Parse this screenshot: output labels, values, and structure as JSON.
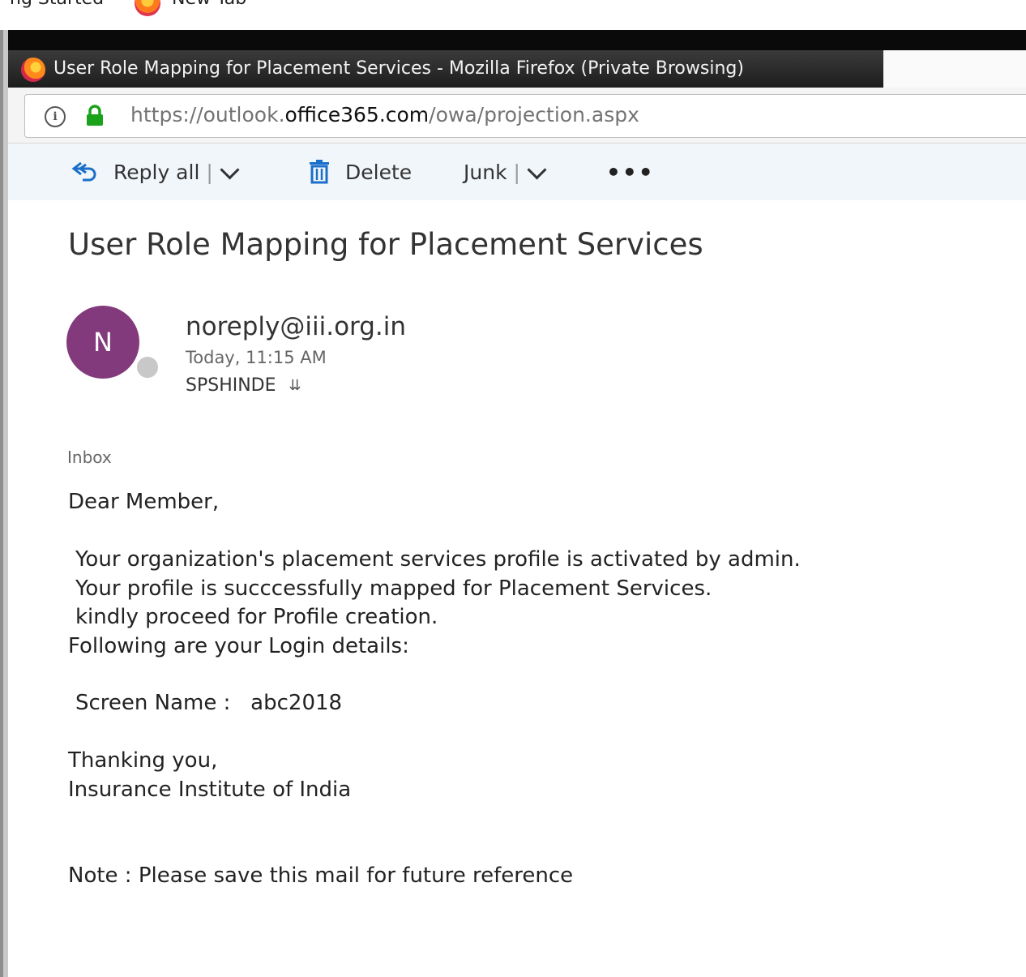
{
  "bookmarks": {
    "items": [
      {
        "label": "ng Started"
      },
      {
        "label": "New Tab"
      }
    ]
  },
  "window": {
    "title": "User Role Mapping for Placement Services - Mozilla Firefox (Private Browsing)"
  },
  "urlbar": {
    "scheme_prefix": "https://outlook.",
    "host": "office365.com",
    "path": "/owa/projection.aspx"
  },
  "toolbar": {
    "reply_all_label": "Reply all",
    "delete_label": "Delete",
    "junk_label": "Junk",
    "separator": "|",
    "more_label": "•••"
  },
  "message": {
    "subject": "User Role Mapping for Placement Services",
    "avatar_initial": "N",
    "sender": "noreply@iii.org.in",
    "date": "Today, 11:15 AM",
    "recipient": "SPSHINDE",
    "folder": "Inbox",
    "body": {
      "greeting": "Dear Member,",
      "line1": "Your organization's placement services profile is activated by admin.",
      "line2": "Your profile is succcessfully mapped for Placement Services.",
      "line3": "kindly proceed for Profile creation.",
      "line4": "Following are your Login details:",
      "screen_name": "Screen Name :   abc2018",
      "thanks": "Thanking you,",
      "signature": "Insurance Institute of India",
      "note": "Note : Please save this mail for future reference"
    }
  },
  "colors": {
    "avatar": "#833a7c",
    "toolbar_bg": "#f1f6fb",
    "accent_blue": "#1a6fc9",
    "lock_green": "#1aa31a"
  },
  "icons": [
    "firefox-icon",
    "info-icon",
    "lock-icon",
    "reply-all-icon",
    "delete-icon",
    "chevron-down-icon",
    "more-icon",
    "presence-icon",
    "expand-icon"
  ]
}
